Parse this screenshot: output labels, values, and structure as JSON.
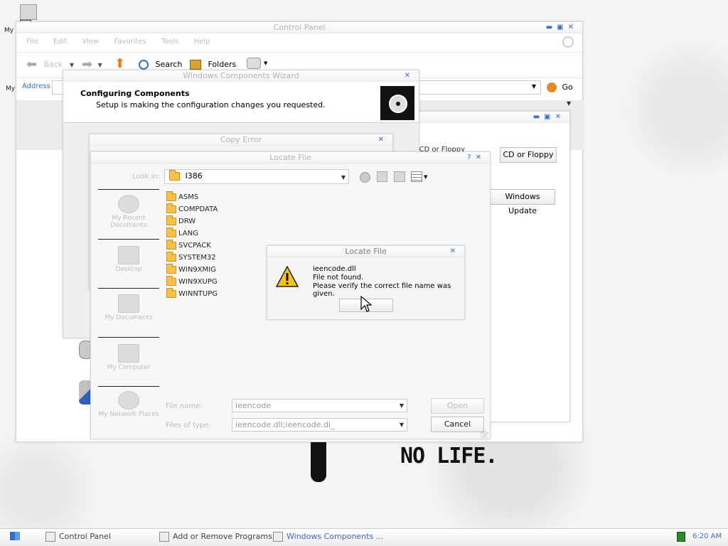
{
  "desktop": {
    "icon_labels": [
      "My",
      "My"
    ],
    "wallpaper_text": "NO LIFE."
  },
  "control_panel": {
    "title": "Control Panel",
    "menu": [
      "File",
      "Edit",
      "View",
      "Favorites",
      "Tools",
      "Help"
    ],
    "toolbar": {
      "back_label": "Back",
      "search_label": "Search",
      "folders_label": "Folders"
    },
    "address_label": "Address",
    "go_label": "Go"
  },
  "add_remove": {
    "partial_text": "ck CD or Floppy",
    "cd_button": "CD or Floppy",
    "update_button": "Windows Update"
  },
  "wizard": {
    "title": "Windows Components Wizard",
    "heading": "Configuring Components",
    "subheading": "Setup is making the configuration changes you requested."
  },
  "copy_error": {
    "title": "Copy Error"
  },
  "locate_file": {
    "title": "Locate File",
    "help_glyph": "?",
    "look_in_label": "Look in:",
    "look_in_value": "I386",
    "folders": [
      "ASMS",
      "COMPDATA",
      "DRW",
      "LANG",
      "SVCPACK",
      "SYSTEM32",
      "WIN9XMIG",
      "WIN9XUPG",
      "WINNTUPG"
    ],
    "places": [
      "My Recent Documents",
      "Desktop",
      "My Documents",
      "My Computer",
      "My Network Places"
    ],
    "file_name_label": "File name:",
    "file_name_value": "ieencode",
    "file_type_label": "Files of type:",
    "file_type_value": "ieencode.dll;ieencode.dl_",
    "open_button": "Open",
    "cancel_button": "Cancel"
  },
  "alert": {
    "title": "Locate File",
    "line1": "ieencode.dll",
    "line2": "File not found.",
    "line3": "Please verify the correct file name was given.",
    "ok_button": ""
  },
  "taskbar": {
    "tasks": [
      {
        "label": "Control Panel"
      },
      {
        "label": "Add or Remove Programs"
      },
      {
        "label": "Windows Components ..."
      }
    ],
    "clock": "6:20 AM"
  },
  "colors": {
    "accent": "#3b6cc8",
    "active_task": "#3b6cc8"
  }
}
